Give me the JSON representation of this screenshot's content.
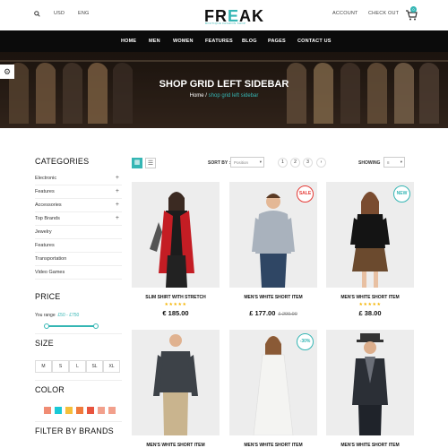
{
  "topbar": {
    "currency": "USD",
    "language": "ENG",
    "account": "ACCOUNT",
    "checkout": "CHECK OUT",
    "cart_count": "0"
  },
  "brand": {
    "logo_pre": "FR",
    "logo_e": "E",
    "logo_post": "AK",
    "tagline": "BOUTIQUE FASHION SHOP",
    "accent": "#35b6b4"
  },
  "nav": [
    "HOME",
    "MEN",
    "WOMEN",
    "FEATURES",
    "BLOG",
    "PAGES",
    "CONTACT US"
  ],
  "hero": {
    "title": "SHOP GRID LEFT SIDEBAR",
    "crumb_home": "Home",
    "crumb_sep": " / ",
    "crumb_current": "shop grid left sidebar"
  },
  "sidebar": {
    "categories_title": "CATEGORIES",
    "categories": [
      {
        "label": "Electronic",
        "expand": "+"
      },
      {
        "label": "Features",
        "expand": "+"
      },
      {
        "label": "Accessories",
        "expand": "+"
      },
      {
        "label": "Top Brands",
        "expand": "+"
      },
      {
        "label": "Jewelry",
        "expand": ""
      },
      {
        "label": "Features",
        "expand": ""
      },
      {
        "label": "Transportation",
        "expand": ""
      },
      {
        "label": "Video Games",
        "expand": ""
      }
    ],
    "price_title": "PRICE",
    "price_label": "You range",
    "price_range": "£50 - £750",
    "size_title": "SIZE",
    "sizes": [
      "M",
      "S",
      "L",
      "SL",
      "XL"
    ],
    "color_title": "COLOR",
    "colors": [
      "#f08c74",
      "#19c9d6",
      "#f5bf3a",
      "#f07a3c",
      "#e8543f",
      "#f2a08c",
      "#f2a08c"
    ],
    "brands_title": "FILTER BY BRANDS"
  },
  "toolbar": {
    "sort_label": "SORT BY :",
    "sort_value": "Position",
    "pages": [
      "1",
      "2",
      "3"
    ],
    "next": "›",
    "showing_label": "SHOWING",
    "showing_value": "8"
  },
  "products": [
    {
      "name": "SLIM SHIRT WITH STRETCH",
      "stars": "★★★★★",
      "price": "€ 185.00",
      "old": "",
      "badge": ""
    },
    {
      "name": "MEN'S WHITE SHORT ITEM",
      "stars": "",
      "price": "£ 177.00",
      "old": "£ 200.00",
      "badge": "SALE"
    },
    {
      "name": "MEN'S WHITE SHORT ITEM",
      "stars": "★★★★★",
      "price": "£ 38.00",
      "old": "",
      "badge": "NEW"
    },
    {
      "name": "MEN'S WHITE SHORT ITEM",
      "stars": "",
      "price": "",
      "old": "",
      "badge": ""
    },
    {
      "name": "MEN'S WHITE SHORT ITEM",
      "stars": "",
      "price": "",
      "old": "",
      "badge": "-30%"
    },
    {
      "name": "MEN'S WHITE SHORT ITEM",
      "stars": "",
      "price": "",
      "old": "",
      "badge": ""
    }
  ]
}
